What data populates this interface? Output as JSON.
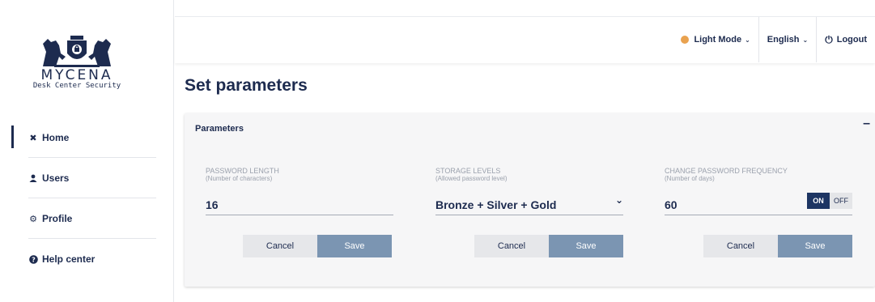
{
  "brand": {
    "name": "MYCENA",
    "tagline": "Desk Center Security"
  },
  "sidebar": {
    "items": [
      {
        "label": "Home",
        "icon": "home-icon"
      },
      {
        "label": "Users",
        "icon": "user-icon"
      },
      {
        "label": "Profile",
        "icon": "gear-icon"
      },
      {
        "label": "Help center",
        "icon": "help-icon"
      }
    ]
  },
  "topbar": {
    "theme_label": "Light Mode",
    "language_label": "English",
    "logout_label": "Logout",
    "theme_dot_color": "#e9a24f"
  },
  "page": {
    "title": "Set parameters"
  },
  "panel": {
    "title": "Parameters",
    "collapse_label": "–",
    "fields": [
      {
        "label": "PASSWORD LENGTH",
        "sublabel": "(Number of characters)",
        "value": "16"
      },
      {
        "label": "STORAGE LEVELS",
        "sublabel": "(Allowed password level)",
        "value": "Bronze + Silver + Gold"
      },
      {
        "label": "CHANGE PASSWORD FREQUENCY",
        "sublabel": "(Number of days)",
        "value": "60",
        "toggle_on": "ON",
        "toggle_off": "OFF",
        "toggle_state": "ON"
      }
    ],
    "cancel_label": "Cancel",
    "save_label": "Save"
  },
  "colors": {
    "primary": "#1d2b4f",
    "save_button": "#7b95b2",
    "toggle_active": "#1d3563"
  }
}
